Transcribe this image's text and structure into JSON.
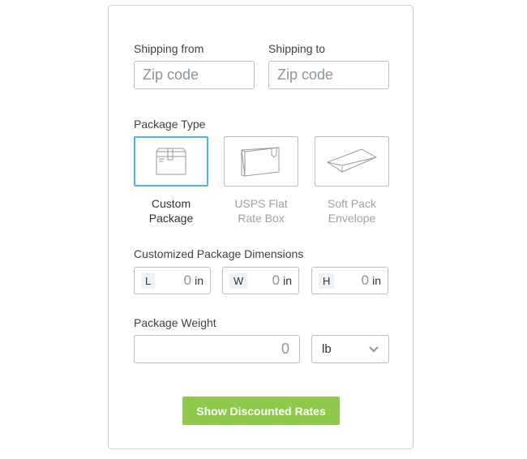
{
  "shipping_from": {
    "label": "Shipping from",
    "placeholder": "Zip code"
  },
  "shipping_to": {
    "label": "Shipping to",
    "placeholder": "Zip code"
  },
  "package_type": {
    "label": "Package Type",
    "options": [
      {
        "label": "Custom Package",
        "icon": "box-icon",
        "selected": true
      },
      {
        "label": "USPS Flat Rate Box",
        "icon": "flat-rate-box-icon",
        "selected": false
      },
      {
        "label": "Soft Pack Envelope",
        "icon": "envelope-icon",
        "selected": false
      }
    ]
  },
  "dimensions": {
    "label": "Customized Package Dimensions",
    "fields": [
      {
        "key": "L",
        "value": "0",
        "unit": "in"
      },
      {
        "key": "W",
        "value": "0",
        "unit": "in"
      },
      {
        "key": "H",
        "value": "0",
        "unit": "in"
      }
    ]
  },
  "weight": {
    "label": "Package Weight",
    "value": "0",
    "unit": "lb"
  },
  "submit_label": "Show Discounted Rates",
  "colors": {
    "accent": "#8fc94a",
    "selected_border": "#4fb3e6"
  }
}
